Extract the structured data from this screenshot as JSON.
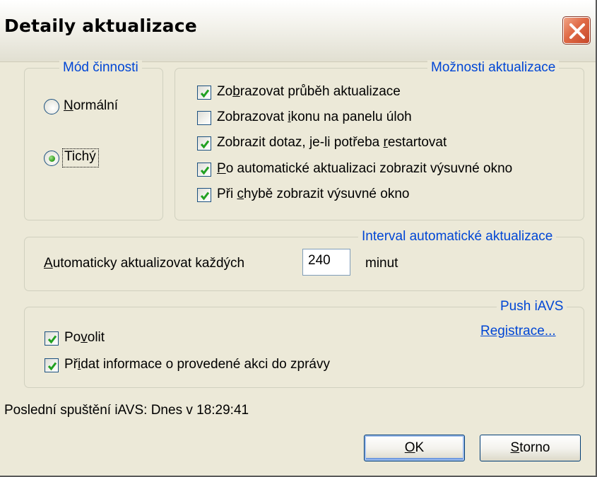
{
  "window": {
    "title": "Detaily aktualizace",
    "close_icon": "close-icon",
    "close_color": "#e06a46"
  },
  "mode_group": {
    "legend": "Mód činnosti",
    "options": [
      {
        "label_u": "N",
        "label_rest": "ormální",
        "selected": false
      },
      {
        "label": "Tichý",
        "selected": true
      }
    ]
  },
  "options_group": {
    "legend": "Možnosti aktualizace",
    "items": [
      {
        "pre": "Zo",
        "u": "b",
        "post": "razovat průběh aktualizace",
        "checked": true
      },
      {
        "pre": "Zobrazovat ",
        "u": "i",
        "post": "konu na panelu úloh",
        "checked": false
      },
      {
        "pre": "Zobrazit dotaz, je-li potřeba ",
        "u": "r",
        "post": "estartovat",
        "checked": true
      },
      {
        "pre": "",
        "u": "P",
        "post": "o automatické aktualizaci zobrazit výsuvné okno",
        "checked": true
      },
      {
        "pre": "Při ",
        "u": "c",
        "post": "hybě zobrazit výsuvné okno",
        "checked": true
      }
    ]
  },
  "interval_group": {
    "legend": "Interval automatické aktualizace",
    "label_u": "A",
    "label_rest": "utomaticky aktualizovat každých",
    "value": "240",
    "unit": "minut"
  },
  "push_group": {
    "legend": "Push iAVS",
    "link": "Registrace...",
    "items": [
      {
        "pre": "Po",
        "u": "v",
        "post": "olit",
        "checked": true
      },
      {
        "pre": "Př",
        "u": "i",
        "post": "dat informace o provedené akci do zprávy",
        "checked": true
      }
    ]
  },
  "status": {
    "text": "Poslední spuštění iAVS: Dnes v 18:29:41"
  },
  "buttons": {
    "ok_u": "O",
    "ok_rest": "K",
    "cancel_u": "S",
    "cancel_rest": "torno"
  },
  "colors": {
    "accent": "#0046d5",
    "check": "#21a121",
    "dialog_bg": "#ece9d8"
  }
}
